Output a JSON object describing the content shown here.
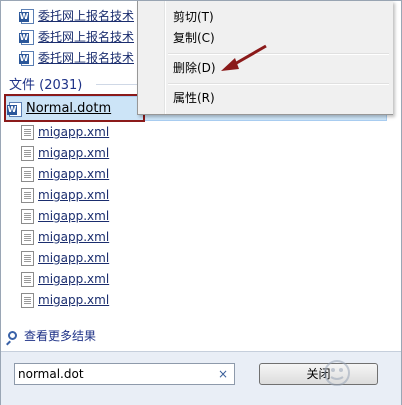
{
  "results": {
    "top_documents": [
      {
        "name": "委托网上报名技术"
      },
      {
        "name": "委托网上报名技术"
      },
      {
        "name": "委托网上报名技术"
      }
    ],
    "group_header": "文件 (2031)",
    "selected_file": "Normal.dotm",
    "files": [
      "migapp.xml",
      "migapp.xml",
      "migapp.xml",
      "migapp.xml",
      "migapp.xml",
      "migapp.xml",
      "migapp.xml",
      "migapp.xml",
      "migapp.xml"
    ],
    "see_more": "查看更多结果"
  },
  "context_menu": {
    "items": [
      {
        "label": "剪切(T)",
        "key": "T"
      },
      {
        "label": "复制(C)",
        "key": "C"
      },
      {
        "label": "删除(D)",
        "key": "D"
      },
      {
        "label": "属性(R)",
        "key": "R"
      }
    ]
  },
  "search": {
    "value": "normal.dot",
    "clear_glyph": "×"
  },
  "close_button": {
    "label": "关闭"
  },
  "colors": {
    "selection": "#cce4f7",
    "highlight_box": "#8b1a1a",
    "arrow": "#8b1a1a",
    "group_header": "#1e3287"
  }
}
